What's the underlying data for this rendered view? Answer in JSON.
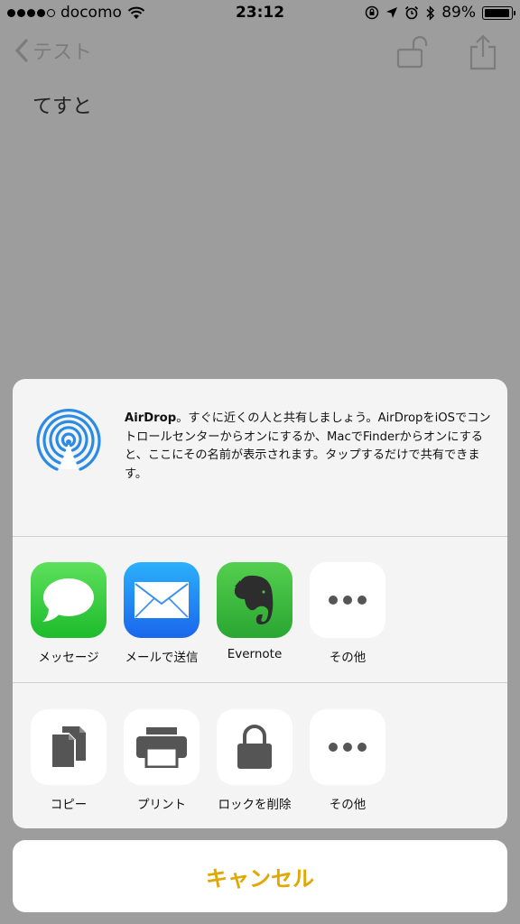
{
  "status_bar": {
    "carrier": "docomo",
    "time": "23:12",
    "battery": "89%",
    "battery_level": 0.89
  },
  "nav": {
    "back_label": "テスト"
  },
  "note": {
    "text": "てすと"
  },
  "airdrop": {
    "title": "AirDrop",
    "description": "。すぐに近くの人と共有しましょう。AirDropをiOSでコントロールセンターからオンにするか、MacでFinderからオンにすると、ここにその名前が表示されます。タップするだけで共有できます。"
  },
  "share_apps": [
    {
      "label": "メッセージ",
      "icon": "messages-icon"
    },
    {
      "label": "メールで送信",
      "icon": "mail-icon"
    },
    {
      "label": "Evernote",
      "icon": "evernote-icon"
    },
    {
      "label": "その他",
      "icon": "more-icon"
    }
  ],
  "actions": [
    {
      "label": "コピー",
      "icon": "copy-icon"
    },
    {
      "label": "プリント",
      "icon": "printer-icon"
    },
    {
      "label": "ロックを削除",
      "icon": "lock-icon"
    },
    {
      "label": "その他",
      "icon": "more-icon"
    }
  ],
  "cancel_label": "キャンセル",
  "colors": {
    "accent": "#e0a800",
    "airdrop_blue": "#2a8be6",
    "messages_green": "#35c53f",
    "mail_blue": "#1f86f0",
    "evernote_green": "#3ab83a"
  }
}
